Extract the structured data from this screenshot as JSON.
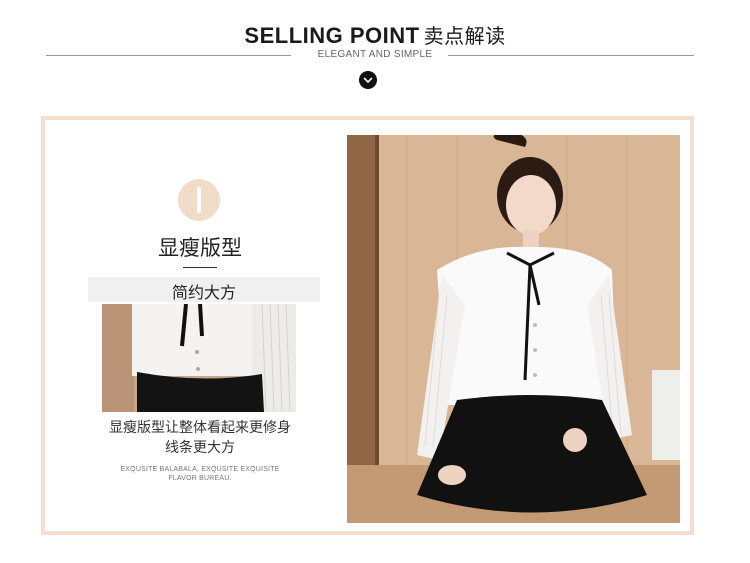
{
  "header": {
    "title": "SELLING POINT",
    "title_cn": "卖点解读",
    "subtitle": "ELEGANT AND SIMPLE"
  },
  "feature": {
    "numeral": "I",
    "title": "显瘦版型",
    "subtitle": "简约大方",
    "description_lines": [
      "显瘦版型让整体看起来更修身",
      "线条更大方"
    ],
    "fine_print_lines": [
      "EXQUSITE BALABALA, EXQUSITE EXQUISITE",
      "FLAVOR BUREAU."
    ]
  },
  "icons": {
    "scroll_down": "chevron-down-icon",
    "numeral_badge": "roman-numeral-one-badge"
  },
  "colors": {
    "frame_border": "#f3dfcf",
    "badge": "#f1dcc8",
    "band": "#f0f0f0",
    "text": "#222222"
  },
  "images": {
    "detail_thumbnail": "close-up of white blouse with black ribbon ties and buttons",
    "model_photo": "model in white ruffle-collar blouse with black bow tie and black skirt, seated against wooden wall"
  }
}
